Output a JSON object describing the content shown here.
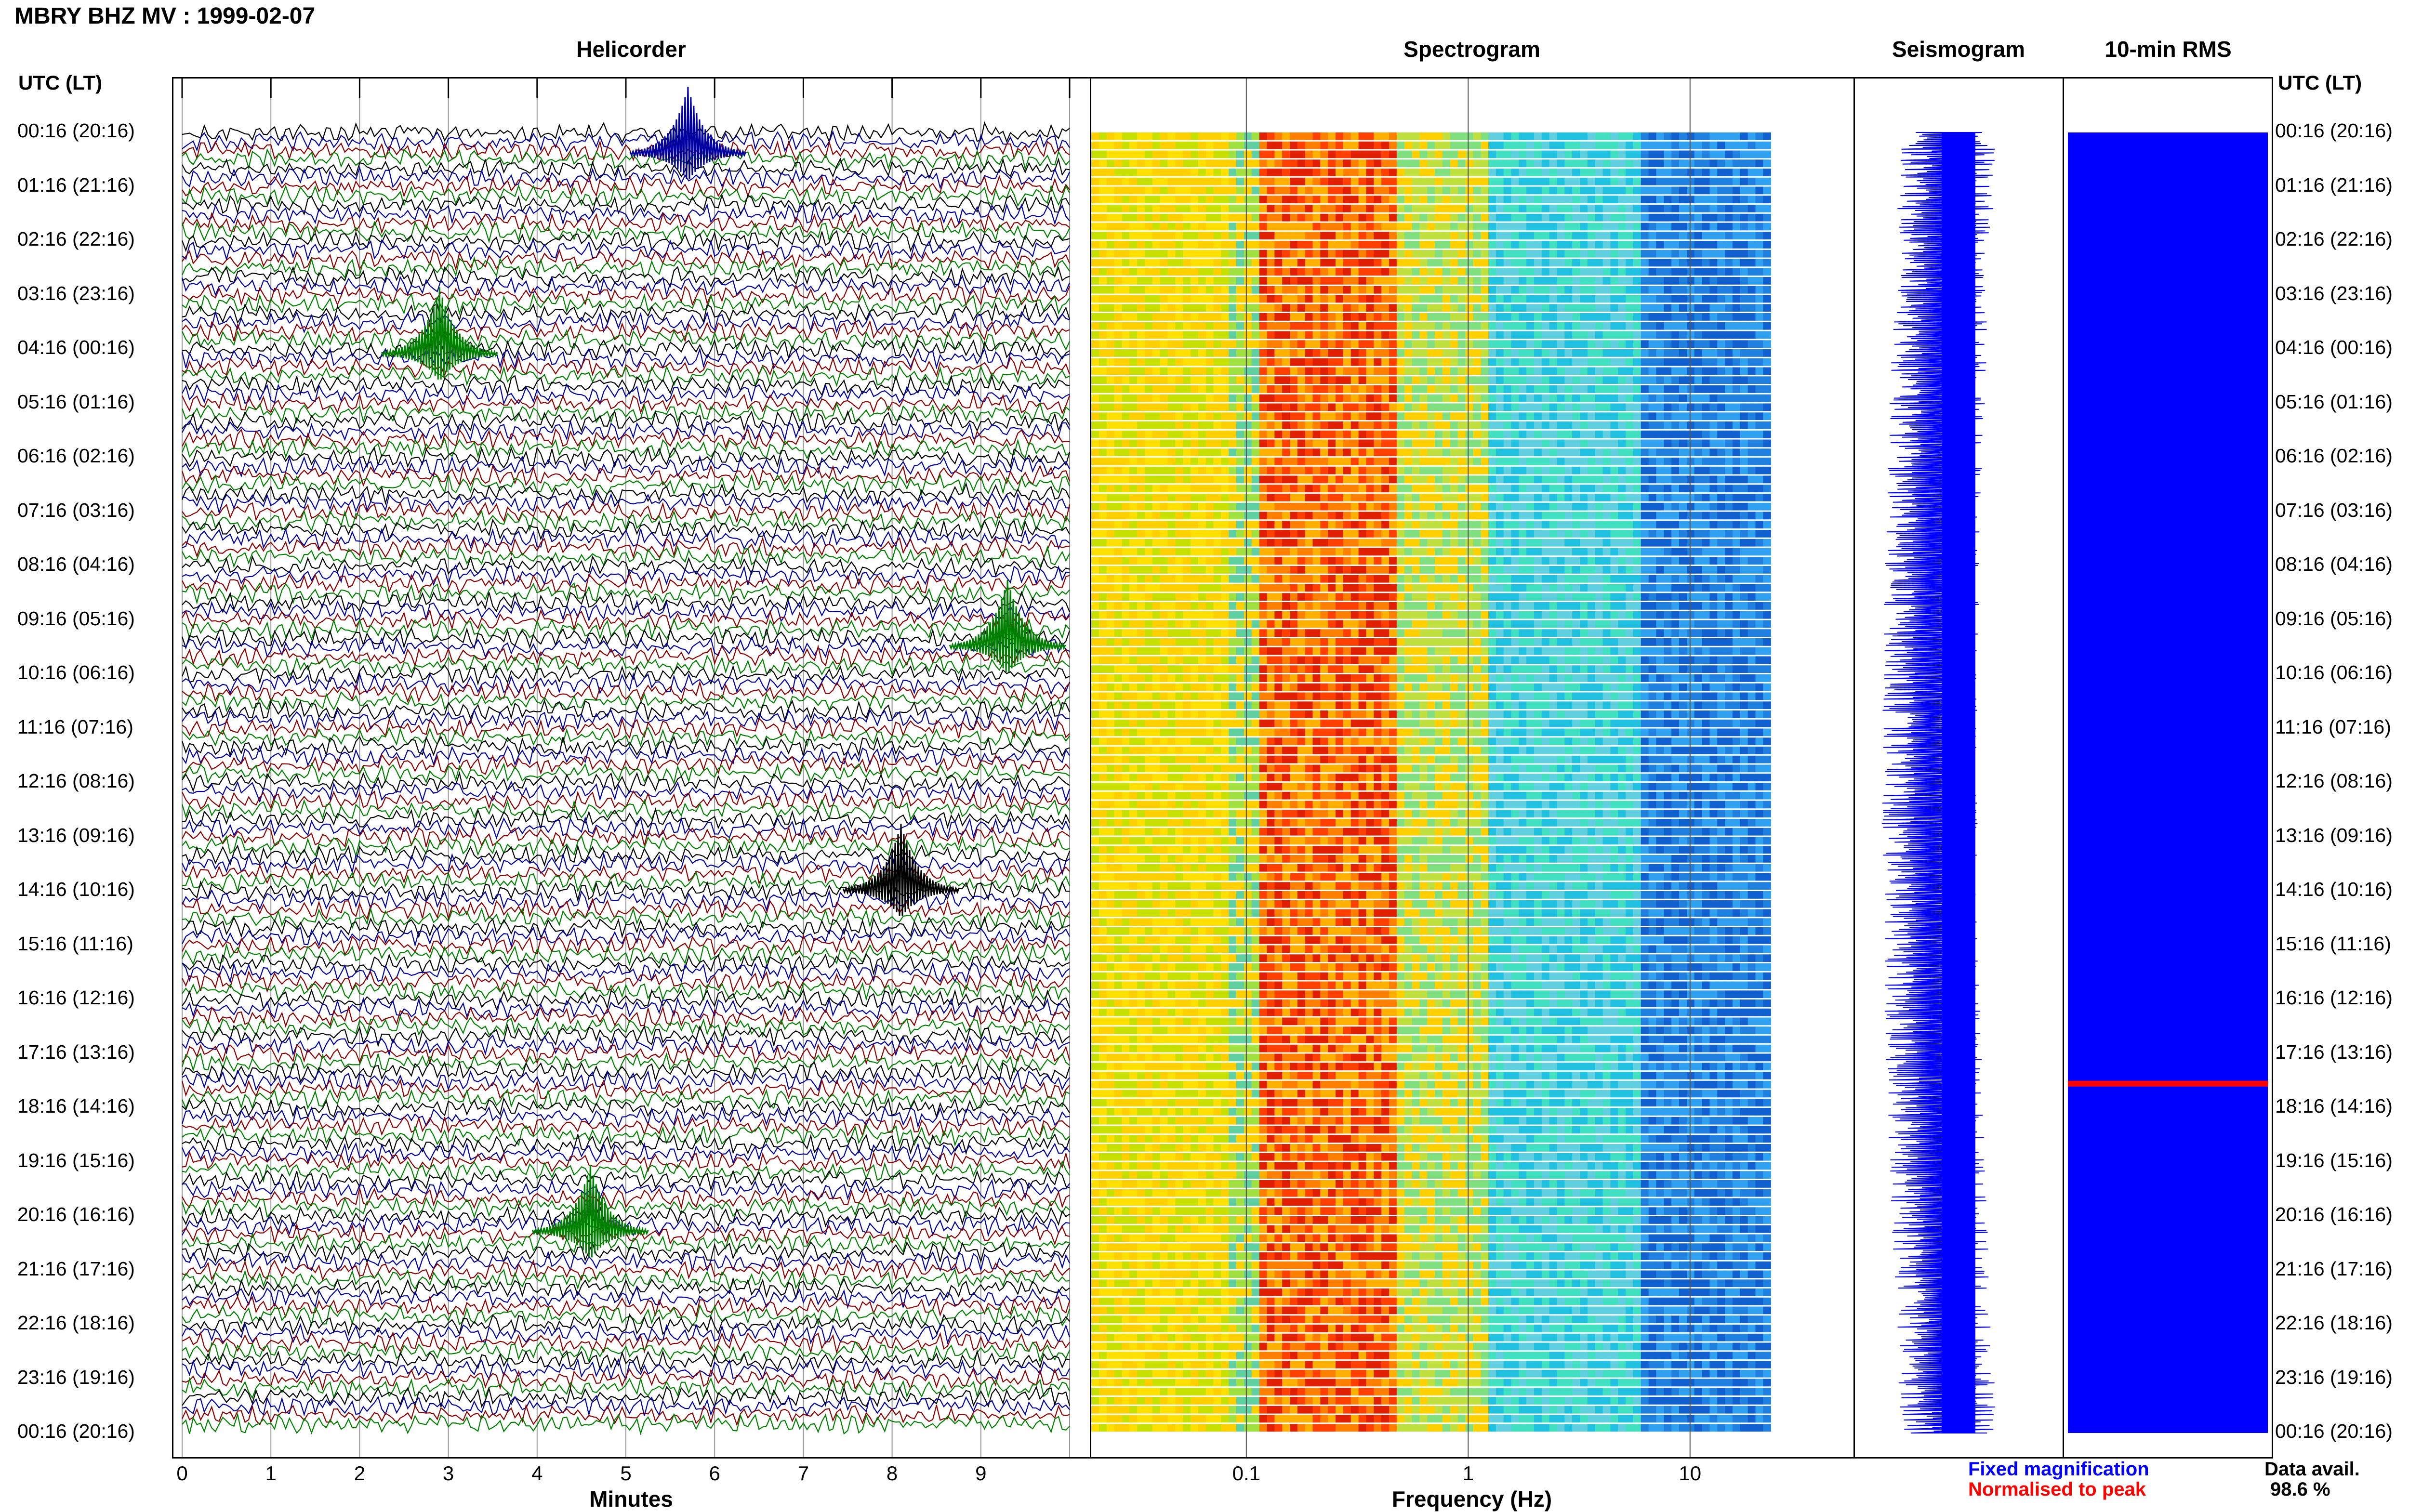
{
  "header": {
    "title": "MBRY BHZ MV : 1999-02-07"
  },
  "panels": {
    "helicorder": "Helicorder",
    "spectrogram": "Spectrogram",
    "seismogram": "Seismogram",
    "rms": "10-min RMS"
  },
  "axis_labels": {
    "left_corner": "UTC (LT)",
    "right_corner": "UTC (LT)",
    "minutes": "Minutes",
    "frequency": "Frequency (Hz)"
  },
  "legend": {
    "fixed": "Fixed magnification",
    "normalised": "Normalised to peak",
    "avail_label": "Data avail.",
    "avail_value": "98.6 %"
  },
  "colors": {
    "trace_cycle": [
      "#000000",
      "#0000a0",
      "#8b0000",
      "#008000"
    ],
    "seismogram": "#0000ff",
    "rms": "#0000ff",
    "rms_peak": "#ff0000"
  },
  "chart_data": [
    {
      "type": "line",
      "name": "helicorder",
      "xlabel": "Minutes",
      "x_ticks": [
        "0",
        "1",
        "2",
        "3",
        "4",
        "5",
        "6",
        "7",
        "8",
        "9"
      ],
      "xlim": [
        0,
        10
      ],
      "time_labels": [
        "00:16 (20:16)",
        "01:16 (21:16)",
        "02:16 (22:16)",
        "03:16 (23:16)",
        "04:16 (00:16)",
        "05:16 (01:16)",
        "06:16 (02:16)",
        "07:16 (03:16)",
        "08:16 (04:16)",
        "09:16 (05:16)",
        "10:16 (06:16)",
        "11:16 (07:16)",
        "12:16 (08:16)",
        "13:16 (09:16)",
        "14:16 (10:16)",
        "15:16 (11:16)",
        "16:16 (12:16)",
        "17:16 (13:16)",
        "18:16 (14:16)",
        "19:16 (15:16)",
        "20:16 (16:16)",
        "21:16 (17:16)",
        "22:16 (18:16)",
        "23:16 (19:16)",
        "00:16 (20:16)"
      ],
      "lines_per_hour": 6,
      "events": [
        {
          "hour": 4.1,
          "minute": 2.9,
          "color": "green"
        },
        {
          "hour": 9.5,
          "minute": 9.3,
          "color": "green"
        },
        {
          "hour": 14.0,
          "minute": 8.1,
          "color": "black"
        },
        {
          "hour": 0.4,
          "minute": 5.7,
          "color": "blue"
        },
        {
          "hour": 20.3,
          "minute": 4.6,
          "color": "green"
        }
      ]
    },
    {
      "type": "heatmap",
      "name": "spectrogram",
      "xlabel": "Frequency (Hz)",
      "x_scale": "log",
      "xlim": [
        0.02,
        40
      ],
      "x_ticks": [
        "0.1",
        "1",
        "10"
      ],
      "peak_band_hz": [
        0.12,
        0.4
      ]
    },
    {
      "type": "line",
      "name": "seismogram",
      "title": "Seismogram"
    },
    {
      "type": "bar",
      "name": "rms",
      "title": "10-min RMS",
      "peak_hour": 17.5
    }
  ]
}
